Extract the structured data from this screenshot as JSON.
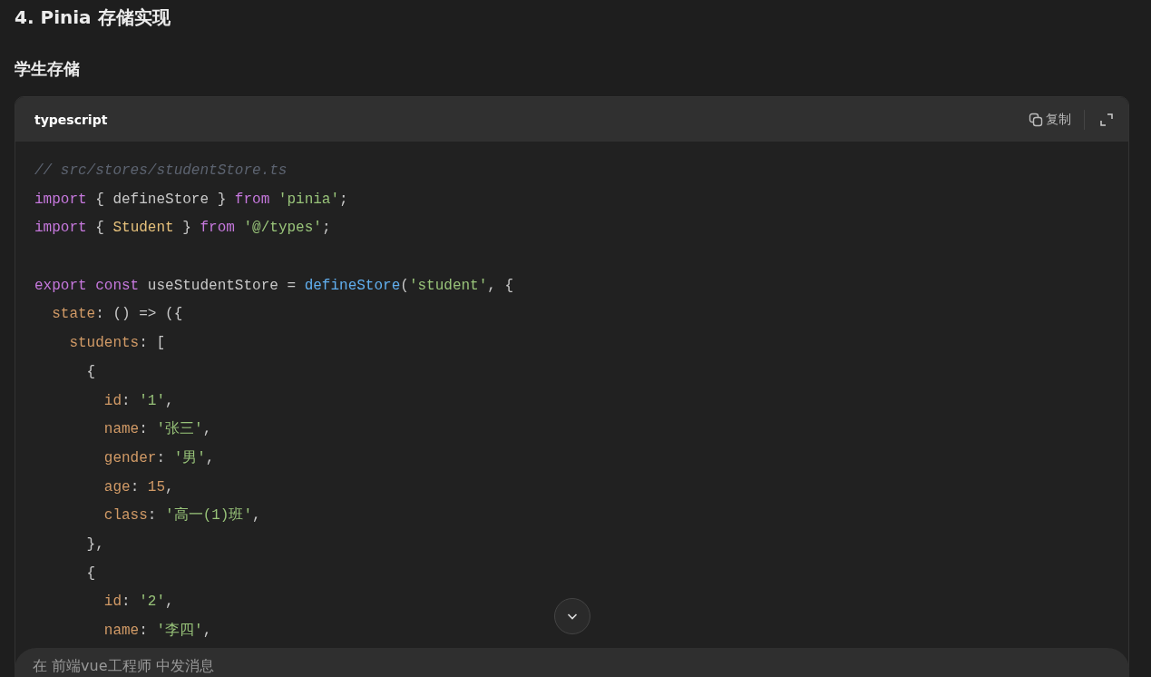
{
  "heading": "4. Pinia 存储实现",
  "subheading": "学生存储",
  "code_block": {
    "language": "typescript",
    "copy_label": "复制",
    "lines": [
      {
        "kind": "code",
        "tokens": [
          {
            "kind": "comment",
            "text": "// src/stores/studentStore.ts"
          }
        ]
      },
      {
        "kind": "code",
        "tokens": [
          {
            "kind": "keyword",
            "text": "import"
          },
          {
            "kind": "plain",
            "text": " { defineStore } "
          },
          {
            "kind": "keyword",
            "text": "from "
          },
          {
            "kind": "string",
            "text": "'pinia'"
          },
          {
            "kind": "plain",
            "text": ";"
          }
        ]
      },
      {
        "kind": "code",
        "tokens": [
          {
            "kind": "keyword",
            "text": "import"
          },
          {
            "kind": "plain",
            "text": " { "
          },
          {
            "kind": "type",
            "text": "Student"
          },
          {
            "kind": "plain",
            "text": " } "
          },
          {
            "kind": "keyword",
            "text": "from "
          },
          {
            "kind": "string",
            "text": "'@/types'"
          },
          {
            "kind": "plain",
            "text": ";"
          }
        ]
      },
      {
        "kind": "blank"
      },
      {
        "kind": "code",
        "tokens": [
          {
            "kind": "keyword",
            "text": "export const"
          },
          {
            "kind": "plain",
            "text": " useStudentStore = "
          },
          {
            "kind": "func",
            "text": "defineStore"
          },
          {
            "kind": "plain",
            "text": "("
          },
          {
            "kind": "string",
            "text": "'student'"
          },
          {
            "kind": "plain",
            "text": ", {"
          }
        ]
      },
      {
        "kind": "code",
        "tokens": [
          {
            "kind": "prop",
            "text": "  state"
          },
          {
            "kind": "plain",
            "text": ": () => ({"
          }
        ]
      },
      {
        "kind": "code",
        "tokens": [
          {
            "kind": "prop",
            "text": "    students"
          },
          {
            "kind": "plain",
            "text": ": ["
          }
        ]
      },
      {
        "kind": "code",
        "tokens": [
          {
            "kind": "plain",
            "text": "      {"
          }
        ]
      },
      {
        "kind": "code",
        "tokens": [
          {
            "kind": "prop",
            "text": "        id"
          },
          {
            "kind": "plain",
            "text": ": "
          },
          {
            "kind": "string",
            "text": "'1'"
          },
          {
            "kind": "plain",
            "text": ","
          }
        ]
      },
      {
        "kind": "code",
        "tokens": [
          {
            "kind": "prop",
            "text": "        name"
          },
          {
            "kind": "plain",
            "text": ": "
          },
          {
            "kind": "string",
            "text": "'张三'"
          },
          {
            "kind": "plain",
            "text": ","
          }
        ]
      },
      {
        "kind": "code",
        "tokens": [
          {
            "kind": "prop",
            "text": "        gender"
          },
          {
            "kind": "plain",
            "text": ": "
          },
          {
            "kind": "string",
            "text": "'男'"
          },
          {
            "kind": "plain",
            "text": ","
          }
        ]
      },
      {
        "kind": "code",
        "tokens": [
          {
            "kind": "prop",
            "text": "        age"
          },
          {
            "kind": "plain",
            "text": ": "
          },
          {
            "kind": "number",
            "text": "15"
          },
          {
            "kind": "plain",
            "text": ","
          }
        ]
      },
      {
        "kind": "code",
        "tokens": [
          {
            "kind": "prop",
            "text": "        class"
          },
          {
            "kind": "plain",
            "text": ": "
          },
          {
            "kind": "string",
            "text": "'高一(1)班'"
          },
          {
            "kind": "plain",
            "text": ","
          }
        ]
      },
      {
        "kind": "code",
        "tokens": [
          {
            "kind": "plain",
            "text": "      },"
          }
        ]
      },
      {
        "kind": "code",
        "tokens": [
          {
            "kind": "plain",
            "text": "      {"
          }
        ]
      },
      {
        "kind": "code",
        "tokens": [
          {
            "kind": "prop",
            "text": "        id"
          },
          {
            "kind": "plain",
            "text": ": "
          },
          {
            "kind": "string",
            "text": "'2'"
          },
          {
            "kind": "plain",
            "text": ","
          }
        ]
      },
      {
        "kind": "code",
        "tokens": [
          {
            "kind": "prop",
            "text": "        name"
          },
          {
            "kind": "plain",
            "text": ": "
          },
          {
            "kind": "string",
            "text": "'李四'"
          },
          {
            "kind": "plain",
            "text": ","
          }
        ]
      }
    ]
  },
  "message_input": {
    "placeholder": "在 前端vue工程师 中发消息"
  }
}
